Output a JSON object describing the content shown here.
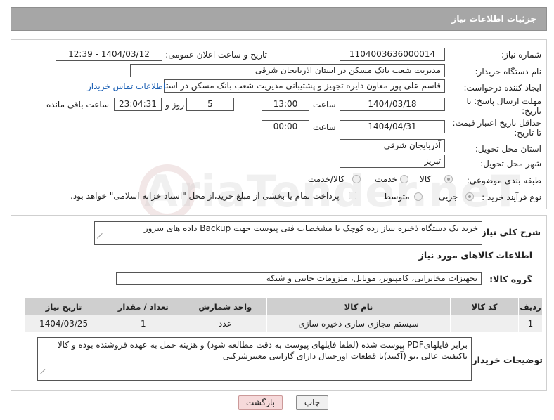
{
  "header": {
    "title": "جزئیات اطلاعات نیاز"
  },
  "form": {
    "need_number": {
      "label": "شماره نیاز:",
      "value": "1104003636000014"
    },
    "announce_datetime": {
      "label": "تاریخ و ساعت اعلان عمومی:",
      "value": "1404/03/12 - 12:39"
    },
    "buyer_org": {
      "label": "نام دستگاه خریدار:",
      "value": "مدیریت شعب بانک مسکن در استان اذربایجان شرقی"
    },
    "requester": {
      "label": "ایجاد کننده درخواست:",
      "value": "قاسم علی پور معاون دایره تجهیز و پشتیبانی مدیریت شعب بانک مسکن در استا",
      "contact_link": "اطلاعات تماس خریدار"
    },
    "reply_deadline": {
      "label_line1": "مهلت ارسال پاسخ: تا",
      "label_line2": "تاریخ:",
      "date": "1404/03/18",
      "time_label": "ساعت",
      "time": "13:00",
      "days": "5",
      "days_label": "روز و",
      "remaining": "23:04:31",
      "remaining_label": "ساعت باقی مانده"
    },
    "price_validity": {
      "label_line1": "حداقل تاریخ اعتبار قیمت:",
      "label_line2": "تا تاریخ:",
      "date": "1404/04/31",
      "time_label": "ساعت",
      "time": "00:00"
    },
    "delivery_province": {
      "label": "استان محل تحویل:",
      "value": "آذربایجان شرقی"
    },
    "delivery_city": {
      "label": "شهر محل تحویل:",
      "value": "تبریز"
    },
    "category": {
      "label": "طبقه بندی موضوعی:",
      "options": [
        "کالا",
        "خدمت",
        "کالا/خدمت"
      ],
      "selected": "کالا"
    },
    "purchase_type": {
      "label": "نوع فرآیند خرید :",
      "options": [
        "جزیی",
        "متوسط"
      ],
      "selected": "جزیی",
      "payment_note": "پرداخت تمام یا بخشی از مبلغ خرید،از محل \"اسناد خزانه اسلامی\" خواهد بود."
    }
  },
  "description": {
    "label": "شرح کلی نیاز:",
    "value": "خرید یک دستگاه ذخیره ساز رده کوچک با مشخصات فنی پیوست جهت Backup داده های سرور"
  },
  "goods": {
    "section_title": "اطلاعات کالاهای مورد نیاز",
    "group_label": "گروه کالا:",
    "group_value": "تجهیزات مخابراتی، کامپیوتر، موبایل، ملزومات جانبی و شبکه",
    "columns": [
      "ردیف",
      "کد کالا",
      "نام کالا",
      "واحد شمارش",
      "تعداد / مقدار",
      "تاریخ نیاز"
    ],
    "rows": [
      {
        "index": "1",
        "code": "--",
        "name": "سیستم مجازی سازی ذخیره سازی",
        "unit": "عدد",
        "qty": "1",
        "date": "1404/03/25"
      }
    ]
  },
  "buyer_notes": {
    "label": "توضیحات خریدار:",
    "line1": "برابر فایلهایPDF پیوست شده (لطفا فایلهای پیوست به دقت مطالعه شود) و هزینه حمل به عهده فروشنده بوده و کالا",
    "line2": "باکیفیت عالی ،نو (آکبند)با قطعات اورجینال دارای گاراتنی معتبرشرکتی"
  },
  "buttons": {
    "print": "چاپ",
    "back": "بازگشت"
  },
  "watermark": {
    "text": "AriaTender.neT"
  }
}
